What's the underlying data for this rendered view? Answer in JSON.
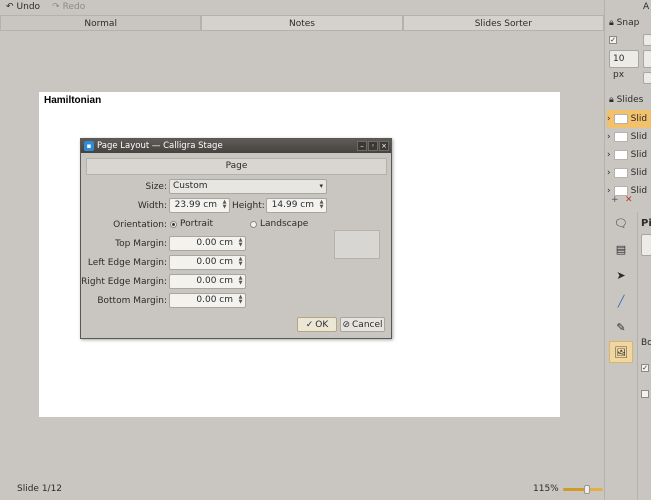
{
  "toolbar": {
    "undo": "Undo",
    "redo": "Redo"
  },
  "view_tabs": [
    "Normal",
    "Notes",
    "Slides Sorter"
  ],
  "slide": {
    "title": "Hamiltonian"
  },
  "status": {
    "slide_counter": "Slide 1/12",
    "zoom": "115%",
    "zoom_fraction": 0.6
  },
  "docker": {
    "snap_label": "Snap",
    "add_label": "A",
    "snap_value": "10 px",
    "slides_label": "Slides",
    "slide_items": [
      "Slid",
      "Slid",
      "Slid",
      "Slid",
      "Slid"
    ],
    "panel_label_1": "Pi",
    "panel_label_2": "Bo"
  },
  "dialog": {
    "title": "Page Layout — Calligra Stage",
    "tab": "Page",
    "size_label": "Size:",
    "size_value": "Custom",
    "width_label": "Width:",
    "width_value": "23.99 cm",
    "height_label": "Height:",
    "height_value": "14.99 cm",
    "orientation_label": "Orientation:",
    "portrait": "Portrait",
    "landscape": "Landscape",
    "top_margin_label": "Top Margin:",
    "top_margin_value": "0.00 cm",
    "left_margin_label": "Left Edge Margin:",
    "left_margin_value": "0.00 cm",
    "right_margin_label": "Right Edge Margin:",
    "right_margin_value": "0.00 cm",
    "bottom_margin_label": "Bottom Margin:",
    "bottom_margin_value": "0.00 cm",
    "ok": "OK",
    "cancel": "Cancel"
  }
}
